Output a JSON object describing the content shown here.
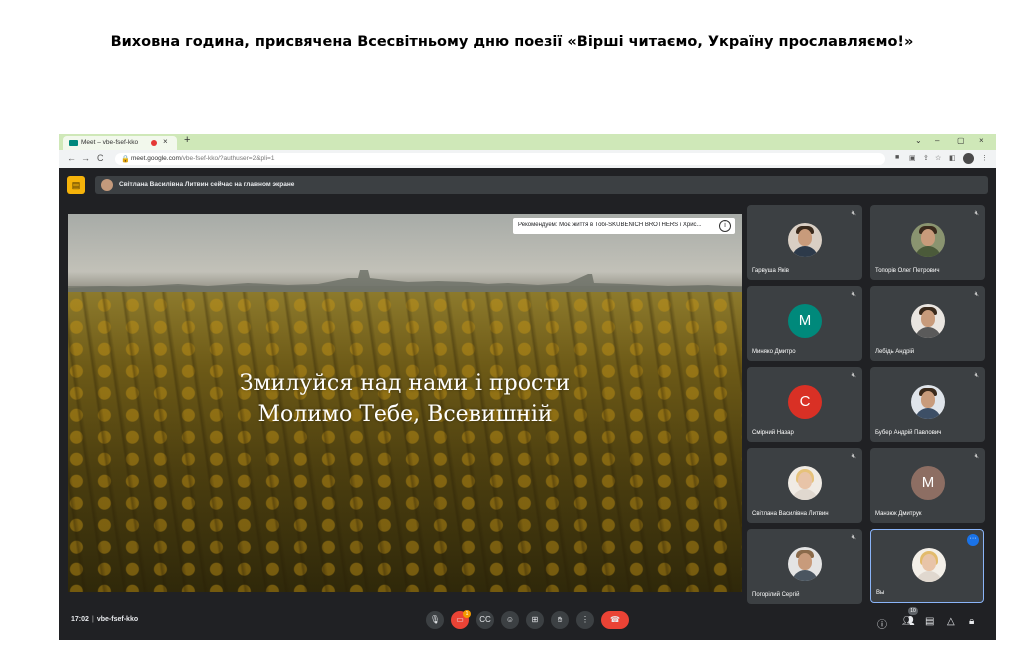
{
  "document": {
    "heading": "Виховна година, присвячена Всесвітньому дню поезії «Вірші читаємо, Україну прославляємо!»"
  },
  "browser": {
    "tab_title": "Meet – vbe-fsef-kko",
    "tab_close": "×",
    "new_tab": "+",
    "window_controls": [
      "⌄",
      "–",
      "▢",
      "×"
    ],
    "nav": [
      "←",
      "→",
      "C"
    ],
    "url_host": "meet.google.com",
    "url_path": "/vbe-fsef-kko/?authuser=2&pli=1",
    "lock": "🔒"
  },
  "meet": {
    "notice": "Світлана Василівна Литвин сейчас на главном экране",
    "recommendation": "Рекомендуем: Моє життя в Тобі-SKUBENICH BROTHERS і Хрис...",
    "info_symbol": "i",
    "verse_line1": "Змилуйся над нами і прости",
    "verse_line2": "Молимо Тебе, Всевишній",
    "participants": [
      {
        "name": "Гарвуша Якiв",
        "type": "photo"
      },
      {
        "name": "Топорiв Олег Петрович",
        "type": "photo"
      },
      {
        "name": "Миняко Дмитро",
        "type": "letter",
        "letter": "M",
        "color": "#00897b"
      },
      {
        "name": "Лебiдь Андрiй",
        "type": "photo"
      },
      {
        "name": "Смiрний Назар",
        "type": "letter",
        "letter": "C",
        "color": "#d93025"
      },
      {
        "name": "Бубер Андрiй Павлович",
        "type": "photo"
      },
      {
        "name": "Свiтлана Василiвна Литвин",
        "type": "photo"
      },
      {
        "name": "Манзюк Дмитрук",
        "type": "letter",
        "letter": "M",
        "color": "#8d6e63"
      },
      {
        "name": "Погорiлий Сергiй",
        "type": "photo"
      },
      {
        "name": "Вы",
        "type": "photo"
      }
    ],
    "time": "17:02",
    "meeting_code": "vbe-fsef-kko",
    "participant_count": "10",
    "reaction_badge": "1"
  },
  "colors": {
    "accent": "#1a73e8",
    "end_call": "#ea4335",
    "present_badge": "#f6b30a"
  },
  "icons": [
    "mic-icon",
    "camera-off-icon",
    "captions-icon",
    "emoji-icon",
    "present-icon",
    "raise-hand-icon",
    "more-options-icon",
    "end-call-icon",
    "info-icon",
    "people-icon",
    "chat-icon",
    "activities-icon",
    "host-controls-icon"
  ]
}
